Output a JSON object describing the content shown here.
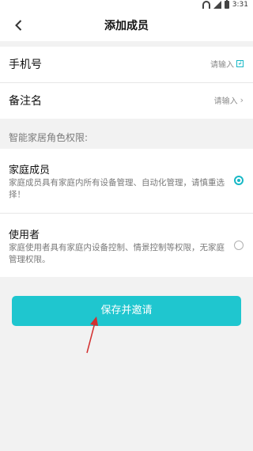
{
  "status_bar": {
    "time": "3:31"
  },
  "header": {
    "title": "添加成员"
  },
  "form": {
    "phone_label": "手机号",
    "phone_placeholder": "请输入",
    "remark_label": "备注名",
    "remark_placeholder": "请输入"
  },
  "permissions": {
    "section_title": "智能家居角色权限:",
    "roles": [
      {
        "title": "家庭成员",
        "desc": "家庭成员具有家庭内所有设备管理、自动化管理，请慎重选择！",
        "selected": true
      },
      {
        "title": "使用者",
        "desc": "家庭使用者具有家庭内设备控制、情景控制等权限，无家庭管理权限。",
        "selected": false
      }
    ]
  },
  "actions": {
    "save_invite_label": "保存并邀请"
  },
  "colors": {
    "accent": "#1fc6cf",
    "accent_dark": "#18b8c6",
    "arrow": "#d32f2f"
  }
}
